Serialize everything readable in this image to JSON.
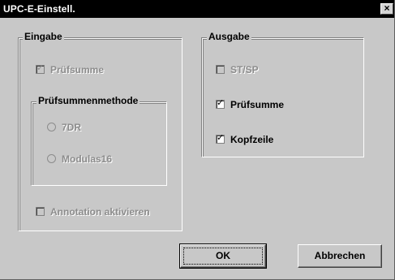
{
  "window": {
    "title": "UPC-E-Einstell.",
    "close_glyph": "×"
  },
  "eingabe": {
    "legend": "Eingabe",
    "pruefsumme": {
      "label": "Prüfsumme",
      "checked": true,
      "enabled": false
    },
    "methode": {
      "legend": "Prüfsummenmethode",
      "options": [
        {
          "label": "7DR",
          "selected": false,
          "enabled": false
        },
        {
          "label": "Modulas16",
          "selected": false,
          "enabled": false
        }
      ]
    },
    "annotation": {
      "label": "Annotation aktivieren",
      "checked": false,
      "enabled": false
    }
  },
  "ausgabe": {
    "legend": "Ausgabe",
    "items": [
      {
        "label": "ST/SP",
        "checked": false,
        "enabled": false
      },
      {
        "label": "Prüfsumme",
        "checked": true,
        "enabled": true
      },
      {
        "label": "Kopfzeile",
        "checked": true,
        "enabled": true
      }
    ]
  },
  "buttons": {
    "ok": "OK",
    "cancel": "Abbrechen"
  },
  "colors": {
    "dialog_bg": "#c8c8c8",
    "titlebar_bg": "#000000",
    "disabled_text": "#8c8c8c"
  },
  "icons": {
    "check_mark": "✓"
  }
}
